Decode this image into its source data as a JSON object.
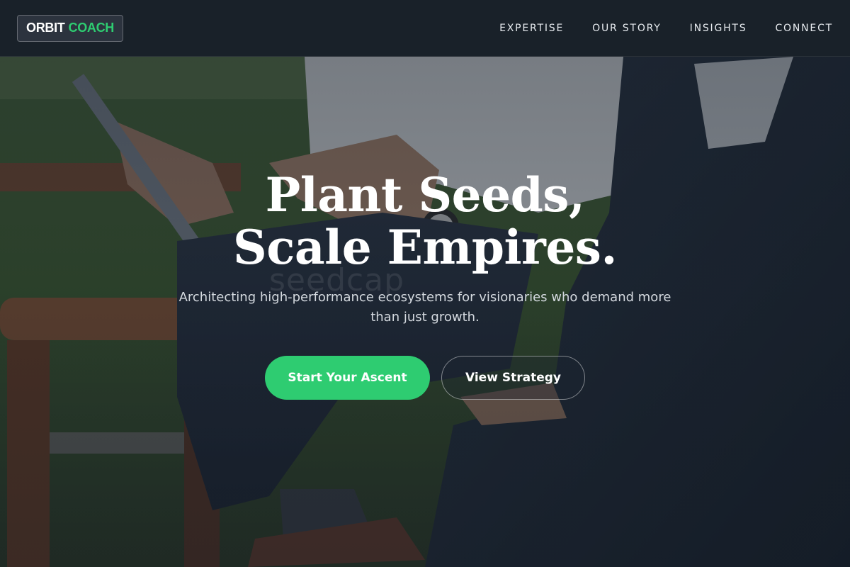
{
  "brand": {
    "word1": "ORBIT",
    "word2": "COACH",
    "accent_color": "#2ecc71"
  },
  "nav": {
    "items": [
      {
        "label": "EXPERTISE"
      },
      {
        "label": "OUR STORY"
      },
      {
        "label": "INSIGHTS"
      },
      {
        "label": "CONNECT"
      }
    ]
  },
  "hero": {
    "title": "Plant Seeds, Scale Empires.",
    "subtitle": "Architecting high-performance ecosystems for visionaries who demand more than just growth.",
    "primary_cta": "Start Your Ascent",
    "secondary_cta": "View Strategy",
    "background_image": "photo-two-businessmen-seated-with-tablet",
    "watermark": "seedcap"
  },
  "colors": {
    "header_bg": "#181f29",
    "primary_button": "#2ecc71",
    "text": "#ffffff"
  }
}
